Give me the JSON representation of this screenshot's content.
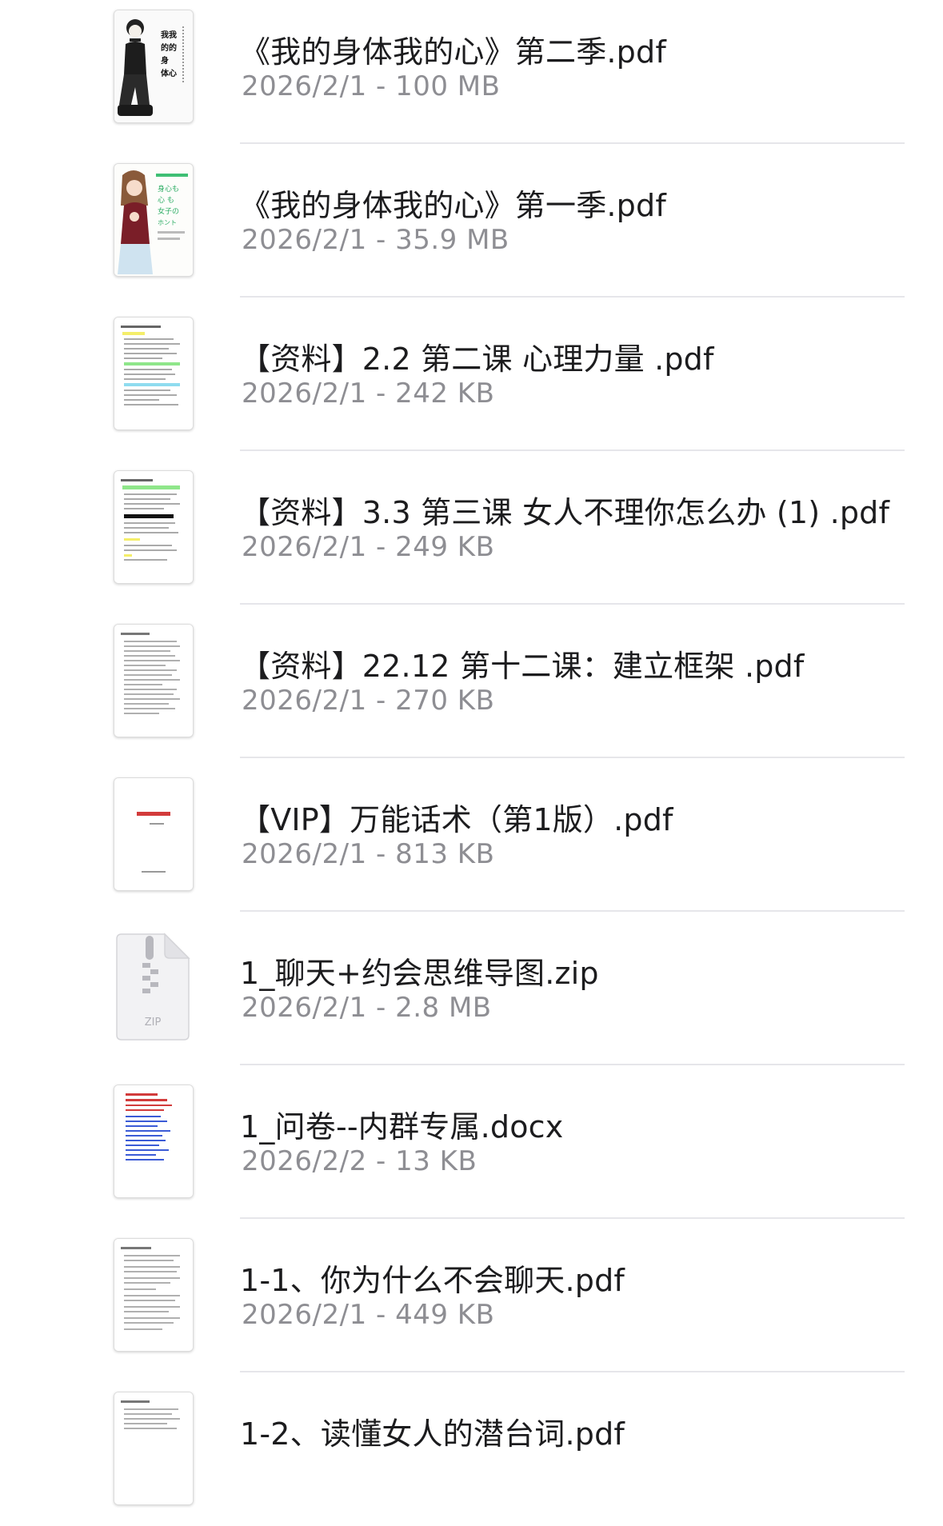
{
  "files": [
    {
      "name": "《我的身体我的心》第二季.pdf",
      "meta": "2026/2/1 - 100 MB",
      "icon": "manga-cover-icon"
    },
    {
      "name": "《我的身体我的心》第一季.pdf",
      "meta": "2026/2/1 - 35.9 MB",
      "icon": "manga-cover-icon"
    },
    {
      "name": "【资料】2.2 第二课 心理力量 .pdf",
      "meta": "2026/2/1 - 242 KB",
      "icon": "pdf-page-icon"
    },
    {
      "name": "【资料】3.3 第三课 女人不理你怎么办 (1) .pdf",
      "meta": "2026/2/1 - 249 KB",
      "icon": "pdf-page-icon"
    },
    {
      "name": "【资料】22.12 第十二课：建立框架 .pdf",
      "meta": "2026/2/1 - 270 KB",
      "icon": "pdf-page-icon"
    },
    {
      "name": "【VIP】万能话术（第1版）.pdf",
      "meta": "2026/2/1 - 813 KB",
      "icon": "pdf-page-icon"
    },
    {
      "name": "1_聊天+约会思维导图.zip",
      "meta": "2026/2/1 - 2.8 MB",
      "icon": "zip-file-icon",
      "icon_label": "ZIP"
    },
    {
      "name": "1_问卷--内群专属.docx",
      "meta": "2026/2/2 - 13 KB",
      "icon": "docx-page-icon"
    },
    {
      "name": "1-1、你为什么不会聊天.pdf",
      "meta": "2026/2/1 - 449 KB",
      "icon": "pdf-page-icon"
    },
    {
      "name": "1-2、读懂女人的潜台词.pdf",
      "meta": "",
      "icon": "pdf-page-icon"
    }
  ],
  "colors": {
    "name_text": "#1c1c1e",
    "meta_text": "#8e8e93",
    "divider": "#e6e6ea",
    "highlight_yellow": "#f4ee6a",
    "highlight_green": "#8fe68a",
    "highlight_cyan": "#8fdcef",
    "link_blue": "#3b5bd6",
    "red_text": "#d23b3b"
  }
}
